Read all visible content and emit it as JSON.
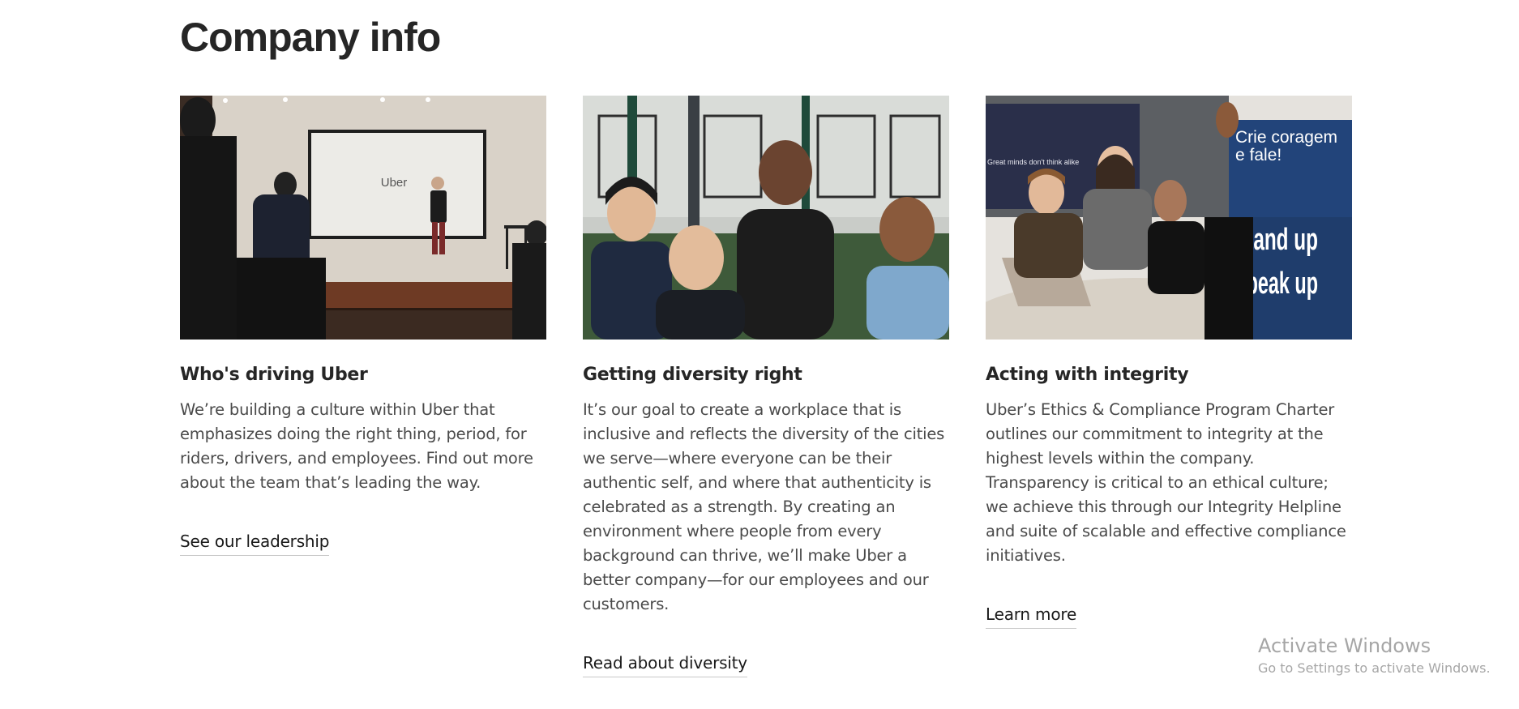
{
  "section": {
    "title": "Company info"
  },
  "cards": [
    {
      "heading": "Who's driving Uber",
      "body": "We’re building a culture within Uber that emphasizes doing the right thing, period, for riders, drivers, and employees. Find out more about the team that’s leading the way.",
      "link": "See our leadership",
      "image_text": "Uber"
    },
    {
      "heading": "Getting diversity right",
      "body": "It’s our goal to create a workplace that is inclusive and reflects the diversity of the cities we serve—where everyone can be their authentic self, and where that authenticity is celebrated as a strength. By creating an environment where people from every background can thrive, we’ll make Uber a better company—for our employees and our customers.",
      "link": "Read about diversity"
    },
    {
      "heading": "Acting with integrity",
      "body": "Uber’s Ethics & Compliance Program Charter outlines our commitment to integrity at the highest levels within the company. Transparency is critical to an ethical culture; we achieve this through our Integrity Helpline and suite of scalable and effective compliance initiatives.",
      "link": "Learn more",
      "image_text": {
        "screen": "Great minds don't think alike",
        "banner_top_1": "Crie coragem",
        "banner_top_2": "e fale!",
        "banner_bottom_1": "Stand up",
        "banner_bottom_2": "Speak up"
      }
    }
  ],
  "watermark": {
    "title": "Activate Windows",
    "subtitle": "Go to Settings to activate Windows."
  }
}
